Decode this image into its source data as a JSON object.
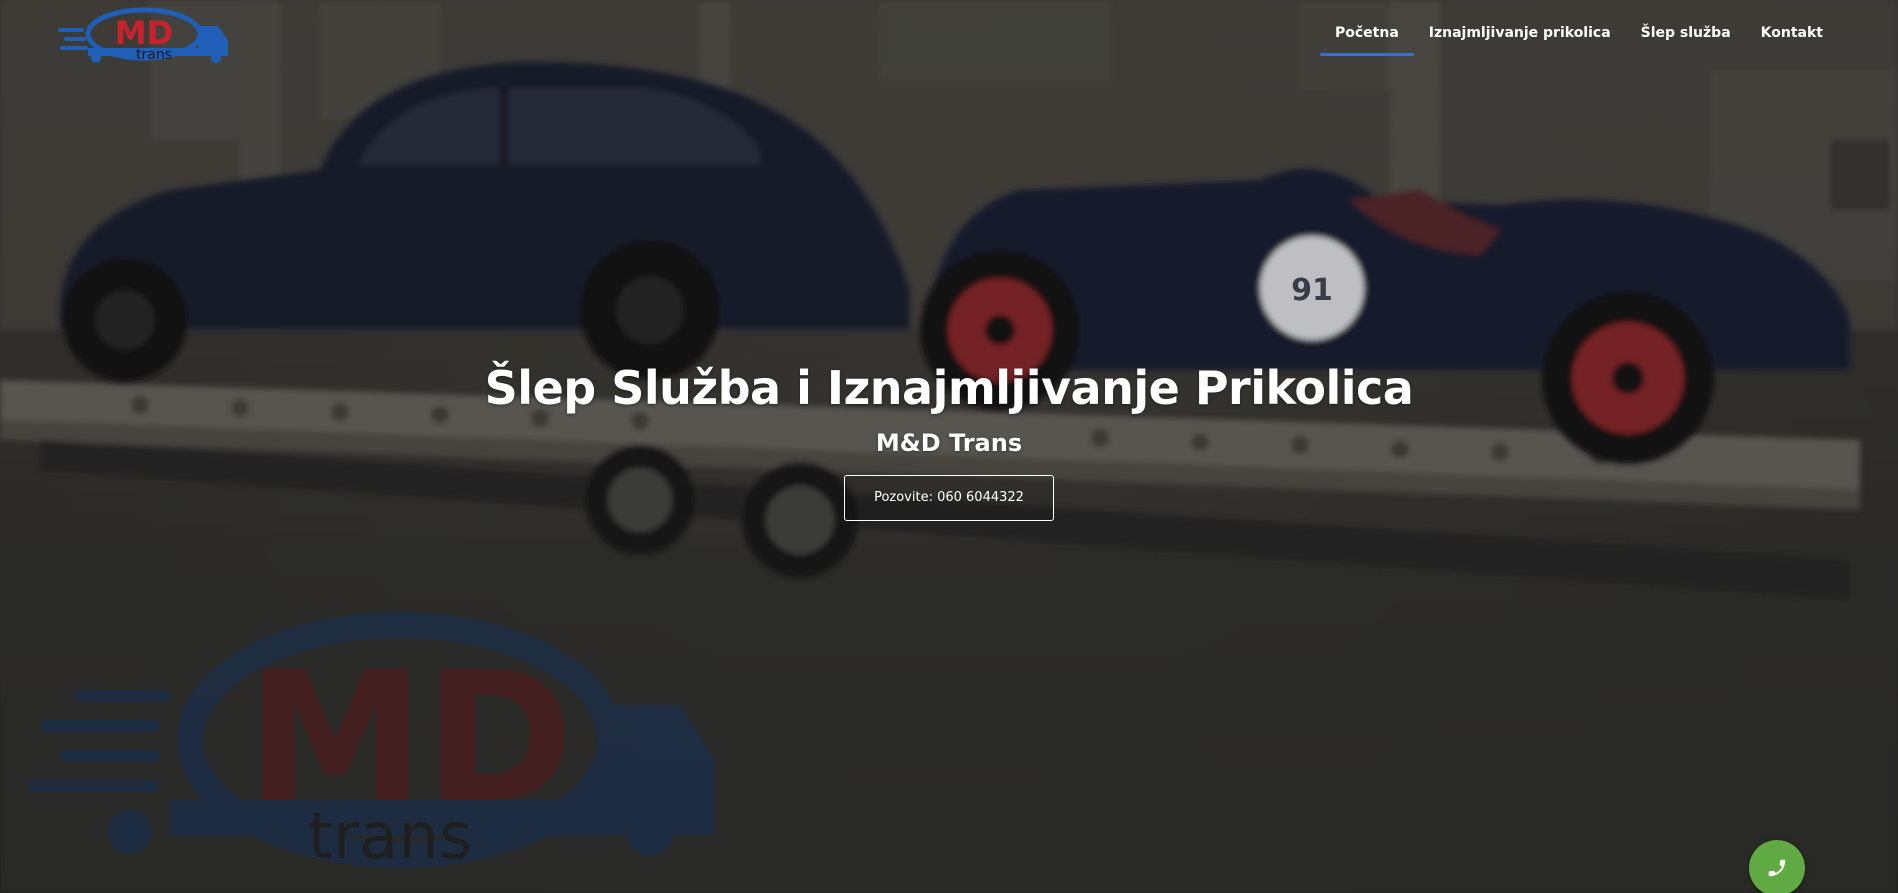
{
  "brand": {
    "logo_letters": "MD",
    "logo_sub": "trans",
    "colors": {
      "logo_red": "#c8232c",
      "logo_blue": "#1f5fb8",
      "nav_active_underline": "#3b6fd1",
      "phone_button": "#5faa43"
    }
  },
  "nav": {
    "items": [
      {
        "label": "Početna",
        "active": true
      },
      {
        "label": "Iznajmljivanje prikolica",
        "active": false
      },
      {
        "label": "Šlep služba",
        "active": false
      },
      {
        "label": "Kontakt",
        "active": false
      }
    ]
  },
  "hero": {
    "title": "Šlep Služba i Iznajmljivanje Prikolica",
    "subtitle": "M&D Trans",
    "cta_label": "Pozovite: 060 6044322",
    "background_logo_letters": "MD",
    "background_logo_sub": "trans",
    "car_number": "91"
  },
  "floating": {
    "icon": "phone-icon"
  }
}
